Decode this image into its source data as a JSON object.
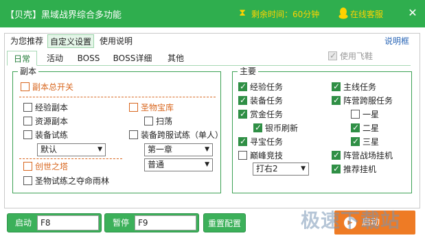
{
  "window": {
    "title": "【贝壳】黑域战界综合多功能",
    "remaining_time": "剩余时间：60分钟",
    "online_service": "在线客服",
    "close_glyph": "✕"
  },
  "tabs": [
    {
      "label": "为您推荐"
    },
    {
      "label": "自定义设置"
    },
    {
      "label": "使用说明"
    }
  ],
  "help_link": "说明框",
  "subtabs": [
    {
      "label": "日常"
    },
    {
      "label": "活动"
    },
    {
      "label": "BOSS"
    },
    {
      "label": "BOSS详细"
    },
    {
      "label": "其他"
    }
  ],
  "fly_shoes": {
    "label": "使用飞鞋",
    "checked": true,
    "enabled": false
  },
  "dungeon": {
    "group_label": "副本",
    "master_switch": {
      "label": "副本总开关",
      "checked": false
    },
    "exp_dungeon": {
      "label": "经验副本",
      "checked": false
    },
    "resource_dungeon": {
      "label": "资源副本",
      "checked": false
    },
    "equip_trial": {
      "label": "装备试练",
      "checked": false
    },
    "equip_trial_select": "默认",
    "creation_tower": {
      "label": "创世之塔",
      "checked": false
    },
    "holy_trial": {
      "label": "圣物试练之夺命雨林",
      "checked": false
    },
    "holy_vault": {
      "label": "圣物宝库",
      "checked": false
    },
    "sweep": {
      "label": "扫荡",
      "checked": false
    },
    "cross_server_trial": {
      "label": "装备跨服试练（单人）",
      "checked": false
    },
    "chapter_select": "第一章",
    "difficulty_select": "普通"
  },
  "main": {
    "group_label": "主要",
    "exp_quest": {
      "label": "经验任务",
      "checked": true
    },
    "equip_quest": {
      "label": "装备任务",
      "checked": true
    },
    "bounty_quest": {
      "label": "赏金任务",
      "checked": true
    },
    "silver_refresh": {
      "label": "银币刷新",
      "checked": true
    },
    "treasure_quest": {
      "label": "寻宝任务",
      "checked": true
    },
    "peak_arena": {
      "label": "巅峰竞技",
      "checked": false
    },
    "peak_arena_select": "打右2",
    "main_quest": {
      "label": "主线任务",
      "checked": true
    },
    "faction_cross_quest": {
      "label": "阵营跨服任务",
      "checked": true
    },
    "star_one": {
      "label": "一星",
      "checked": false
    },
    "star_two": {
      "label": "二星",
      "checked": true
    },
    "star_three": {
      "label": "三星",
      "checked": true
    },
    "faction_battle_afk": {
      "label": "阵营战场挂机",
      "checked": true
    },
    "recommend_afk": {
      "label": "推荐挂机",
      "checked": true
    }
  },
  "bottom": {
    "start_label": "启动",
    "start_key": "F8",
    "pause_label": "暂停",
    "pause_key": "F9",
    "reset_label": "重置配置",
    "start_big_label": "启动",
    "watermark": "极速下载站"
  },
  "colors": {
    "titlebar": "#2fae4e",
    "accent_yellow": "#ffd200",
    "orange": "#d8661e",
    "check_green": "#2f8f45",
    "start_orange": "#ee7b25"
  }
}
